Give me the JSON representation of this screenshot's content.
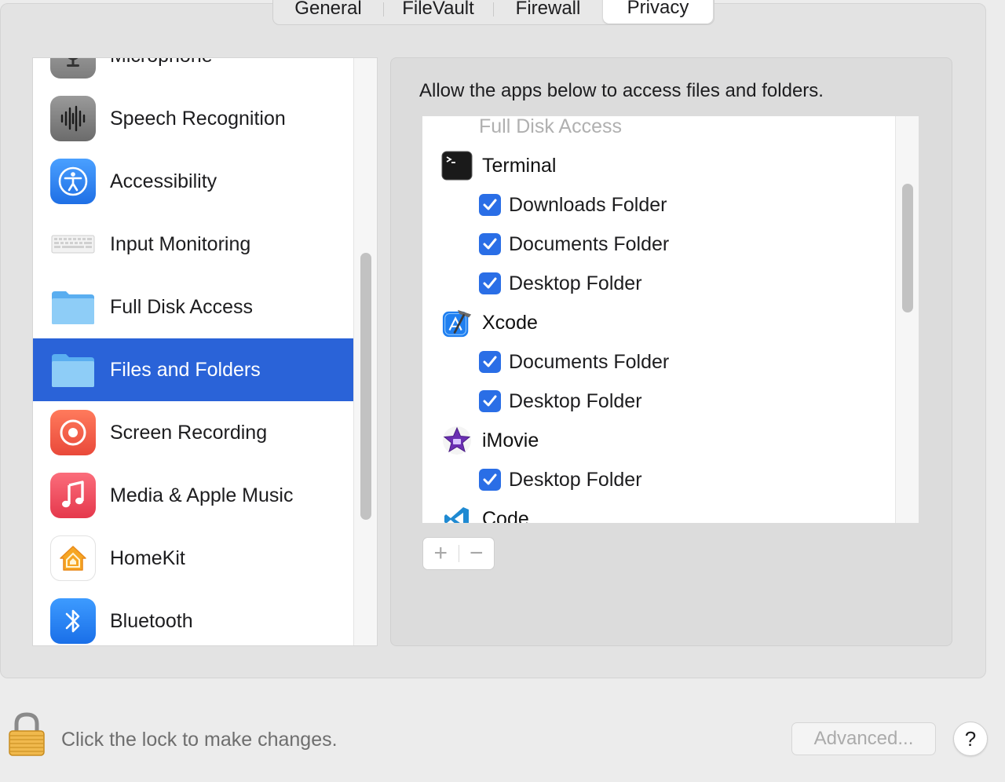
{
  "tabs": [
    {
      "label": "General",
      "active": false
    },
    {
      "label": "FileVault",
      "active": false
    },
    {
      "label": "Firewall",
      "active": false
    },
    {
      "label": "Privacy",
      "active": true
    }
  ],
  "sidebar": {
    "items": [
      {
        "label": "Microphone",
        "icon": "microphone-icon"
      },
      {
        "label": "Speech Recognition",
        "icon": "waveform-icon"
      },
      {
        "label": "Accessibility",
        "icon": "accessibility-icon"
      },
      {
        "label": "Input Monitoring",
        "icon": "keyboard-icon"
      },
      {
        "label": "Full Disk Access",
        "icon": "folder-icon"
      },
      {
        "label": "Files and Folders",
        "icon": "folder-icon",
        "selected": true
      },
      {
        "label": "Screen Recording",
        "icon": "screen-recording-icon"
      },
      {
        "label": "Media & Apple Music",
        "icon": "music-note-icon"
      },
      {
        "label": "HomeKit",
        "icon": "homekit-icon"
      },
      {
        "label": "Bluetooth",
        "icon": "bluetooth-icon"
      }
    ]
  },
  "content": {
    "description": "Allow the apps below to access files and folders.",
    "section_label": "Full Disk Access",
    "apps": [
      {
        "name": "Terminal",
        "icon": "terminal-icon",
        "folders": [
          "Downloads Folder",
          "Documents Folder",
          "Desktop Folder"
        ]
      },
      {
        "name": "Xcode",
        "icon": "xcode-icon",
        "folders": [
          "Documents Folder",
          "Desktop Folder"
        ]
      },
      {
        "name": "iMovie",
        "icon": "imovie-icon",
        "folders": [
          "Desktop Folder"
        ]
      },
      {
        "name": "Code",
        "icon": "vscode-icon",
        "folders": []
      }
    ],
    "add_label": "+",
    "remove_label": "−"
  },
  "footer": {
    "lock_text": "Click the lock to make changes.",
    "advanced_label": "Advanced...",
    "help_label": "?"
  },
  "colors": {
    "selection": "#2a63d8",
    "checkbox": "#2a6ee6"
  }
}
